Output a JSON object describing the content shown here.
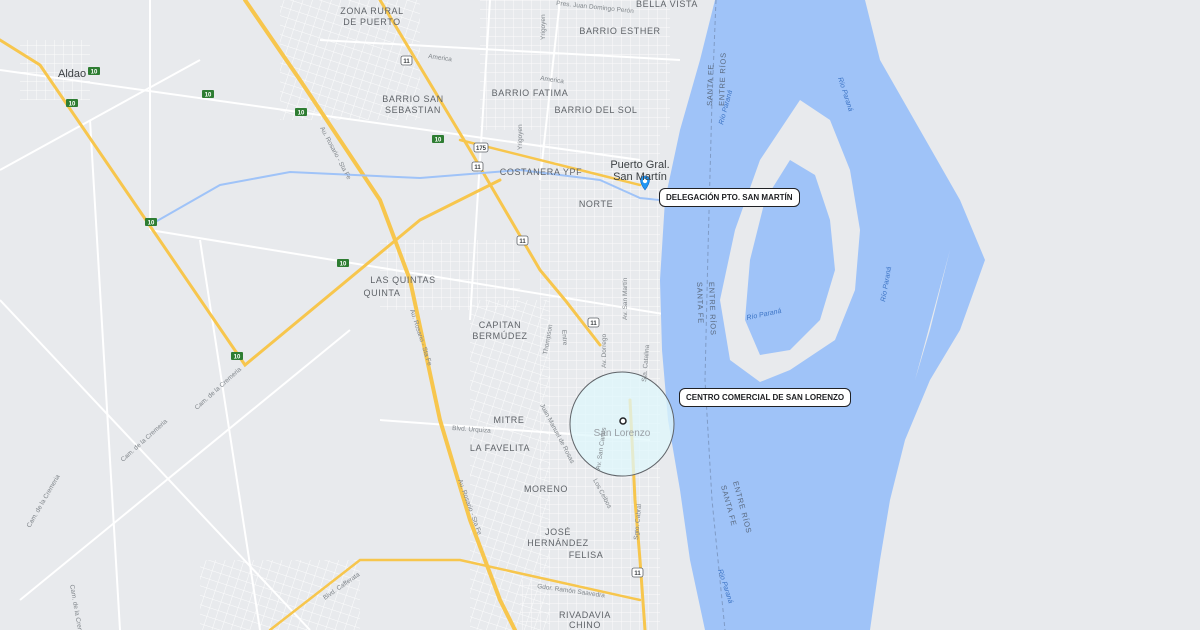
{
  "map": {
    "water_color": "#9fc3f8",
    "land_color": "#e8eaed",
    "highway_color": "#f7c64d",
    "marker_color": "#2196f3",
    "area_circle_color": "#dff7fb",
    "places": {
      "aldao": "Aldao",
      "zona_rural_1": "ZONA RURAL",
      "zona_rural_2": "DE PUERTO",
      "bella_vista": "BELLA VISTA",
      "barrio_esther": "BARRIO ESTHER",
      "barrio_fatima": "BARRIO FATIMA",
      "barrio_del_sol": "BARRIO DEL SOL",
      "barrio_ss_1": "BARRIO SAN",
      "barrio_ss_2": "SEBASTIAN",
      "puerto_1": "Puerto Gral.",
      "puerto_2": "San Martín",
      "norte": "NORTE",
      "las_quintas_1": "LAS QUINTAS",
      "las_quintas_2": "QUINTA",
      "capitan_1": "CAPITAN",
      "capitan_2": "BERMÚDEZ",
      "mitre": "MITRE",
      "la_favelita": "LA FAVELITA",
      "moreno": "MORENO",
      "jose_1": "JOSÉ",
      "jose_2": "HERNÁNDEZ",
      "felisa": "FELISA",
      "rivadavia": "RIVADAVIA",
      "chino": "CHINO",
      "san_lorenzo": "San Lorenzo"
    },
    "streets": {
      "costanera": "COSTANERA YPF",
      "america_1": "America",
      "america_2": "America",
      "au_rosario_1": "Au. Rosario - Sta Fe",
      "au_rosario_2": "Au. Rosario - Sta Fe",
      "au_rosario_3": "Au. Rosario - Sta Fe",
      "camino_cremeria_1": "Cam. de la Cremeria",
      "camino_cremeria_2": "Cam. de la Cremeria",
      "camino_cremeria_3": "Cam. de la Cremeria",
      "camino_cremeria_4": "Cam. de la Cremeria",
      "bv_urquiza": "Blvd. Urquiza",
      "gdor_saavedra": "Gdor. Ramón Saavedra",
      "bv_cafferata": "Blvd. Cafferata",
      "av_san_martin": "Av. San Martín",
      "av_dorrego": "Av. Dorrego",
      "yrigoyen_1": "Yrigoyen",
      "yrigoyen_2": "Yrigoyen",
      "pte_peron": "Pres. Juan Domingo Perón",
      "jm_rosas": "Juan Manuel de Rosas",
      "thompson": "Thompson",
      "entre": "Entre",
      "sargento_cabral": "Sgto. Cabral",
      "sta_catalina": "Sta. Catalina",
      "los_ceibos": "Los Ceibos",
      "san_carlos": "Av. San Carlos"
    },
    "rivers": {
      "parana_1": "Río Paraná",
      "parana_2": "Río Paraná",
      "parana_3": "Río Paraná",
      "parana_4": "Río Paraná",
      "parana_5": "Río Paraná"
    },
    "borders": {
      "b1a": "SANTA FE",
      "b1b": "ENTRE RÍOS",
      "b2a": "ENTRE RÍOS",
      "b2b": "SANTA FE",
      "b3a": "ENTRE RÍOS",
      "b3b": "SANTA FE"
    },
    "shields": {
      "r11": "11",
      "r10": "10",
      "r175": "175"
    },
    "callouts": {
      "delegacion": "DELEGACIÓN PTO. SAN MARTÍN",
      "centro": "CENTRO COMERCIAL DE SAN LORENZO"
    }
  }
}
